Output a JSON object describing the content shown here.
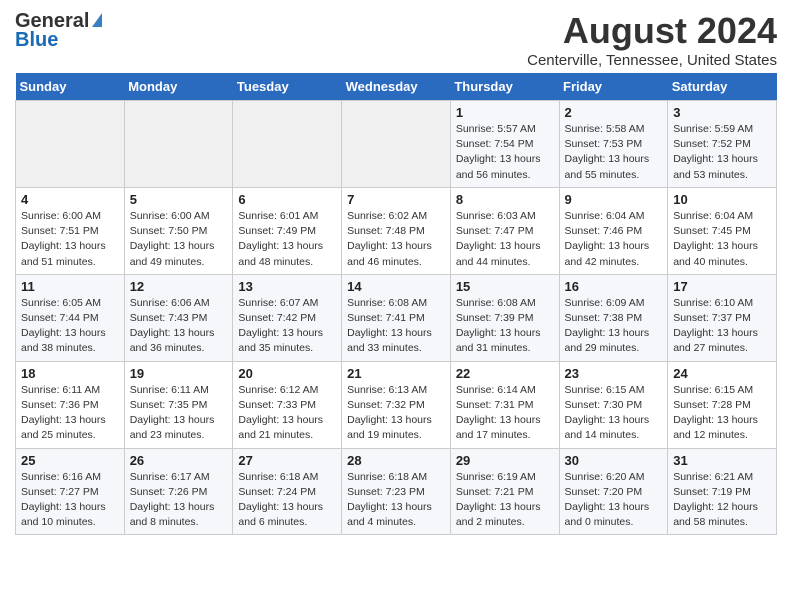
{
  "logo": {
    "general": "General",
    "blue": "Blue"
  },
  "title": "August 2024",
  "location": "Centerville, Tennessee, United States",
  "days_of_week": [
    "Sunday",
    "Monday",
    "Tuesday",
    "Wednesday",
    "Thursday",
    "Friday",
    "Saturday"
  ],
  "weeks": [
    [
      {
        "day": "",
        "info": ""
      },
      {
        "day": "",
        "info": ""
      },
      {
        "day": "",
        "info": ""
      },
      {
        "day": "",
        "info": ""
      },
      {
        "day": "1",
        "info": "Sunrise: 5:57 AM\nSunset: 7:54 PM\nDaylight: 13 hours\nand 56 minutes."
      },
      {
        "day": "2",
        "info": "Sunrise: 5:58 AM\nSunset: 7:53 PM\nDaylight: 13 hours\nand 55 minutes."
      },
      {
        "day": "3",
        "info": "Sunrise: 5:59 AM\nSunset: 7:52 PM\nDaylight: 13 hours\nand 53 minutes."
      }
    ],
    [
      {
        "day": "4",
        "info": "Sunrise: 6:00 AM\nSunset: 7:51 PM\nDaylight: 13 hours\nand 51 minutes."
      },
      {
        "day": "5",
        "info": "Sunrise: 6:00 AM\nSunset: 7:50 PM\nDaylight: 13 hours\nand 49 minutes."
      },
      {
        "day": "6",
        "info": "Sunrise: 6:01 AM\nSunset: 7:49 PM\nDaylight: 13 hours\nand 48 minutes."
      },
      {
        "day": "7",
        "info": "Sunrise: 6:02 AM\nSunset: 7:48 PM\nDaylight: 13 hours\nand 46 minutes."
      },
      {
        "day": "8",
        "info": "Sunrise: 6:03 AM\nSunset: 7:47 PM\nDaylight: 13 hours\nand 44 minutes."
      },
      {
        "day": "9",
        "info": "Sunrise: 6:04 AM\nSunset: 7:46 PM\nDaylight: 13 hours\nand 42 minutes."
      },
      {
        "day": "10",
        "info": "Sunrise: 6:04 AM\nSunset: 7:45 PM\nDaylight: 13 hours\nand 40 minutes."
      }
    ],
    [
      {
        "day": "11",
        "info": "Sunrise: 6:05 AM\nSunset: 7:44 PM\nDaylight: 13 hours\nand 38 minutes."
      },
      {
        "day": "12",
        "info": "Sunrise: 6:06 AM\nSunset: 7:43 PM\nDaylight: 13 hours\nand 36 minutes."
      },
      {
        "day": "13",
        "info": "Sunrise: 6:07 AM\nSunset: 7:42 PM\nDaylight: 13 hours\nand 35 minutes."
      },
      {
        "day": "14",
        "info": "Sunrise: 6:08 AM\nSunset: 7:41 PM\nDaylight: 13 hours\nand 33 minutes."
      },
      {
        "day": "15",
        "info": "Sunrise: 6:08 AM\nSunset: 7:39 PM\nDaylight: 13 hours\nand 31 minutes."
      },
      {
        "day": "16",
        "info": "Sunrise: 6:09 AM\nSunset: 7:38 PM\nDaylight: 13 hours\nand 29 minutes."
      },
      {
        "day": "17",
        "info": "Sunrise: 6:10 AM\nSunset: 7:37 PM\nDaylight: 13 hours\nand 27 minutes."
      }
    ],
    [
      {
        "day": "18",
        "info": "Sunrise: 6:11 AM\nSunset: 7:36 PM\nDaylight: 13 hours\nand 25 minutes."
      },
      {
        "day": "19",
        "info": "Sunrise: 6:11 AM\nSunset: 7:35 PM\nDaylight: 13 hours\nand 23 minutes."
      },
      {
        "day": "20",
        "info": "Sunrise: 6:12 AM\nSunset: 7:33 PM\nDaylight: 13 hours\nand 21 minutes."
      },
      {
        "day": "21",
        "info": "Sunrise: 6:13 AM\nSunset: 7:32 PM\nDaylight: 13 hours\nand 19 minutes."
      },
      {
        "day": "22",
        "info": "Sunrise: 6:14 AM\nSunset: 7:31 PM\nDaylight: 13 hours\nand 17 minutes."
      },
      {
        "day": "23",
        "info": "Sunrise: 6:15 AM\nSunset: 7:30 PM\nDaylight: 13 hours\nand 14 minutes."
      },
      {
        "day": "24",
        "info": "Sunrise: 6:15 AM\nSunset: 7:28 PM\nDaylight: 13 hours\nand 12 minutes."
      }
    ],
    [
      {
        "day": "25",
        "info": "Sunrise: 6:16 AM\nSunset: 7:27 PM\nDaylight: 13 hours\nand 10 minutes."
      },
      {
        "day": "26",
        "info": "Sunrise: 6:17 AM\nSunset: 7:26 PM\nDaylight: 13 hours\nand 8 minutes."
      },
      {
        "day": "27",
        "info": "Sunrise: 6:18 AM\nSunset: 7:24 PM\nDaylight: 13 hours\nand 6 minutes."
      },
      {
        "day": "28",
        "info": "Sunrise: 6:18 AM\nSunset: 7:23 PM\nDaylight: 13 hours\nand 4 minutes."
      },
      {
        "day": "29",
        "info": "Sunrise: 6:19 AM\nSunset: 7:21 PM\nDaylight: 13 hours\nand 2 minutes."
      },
      {
        "day": "30",
        "info": "Sunrise: 6:20 AM\nSunset: 7:20 PM\nDaylight: 13 hours\nand 0 minutes."
      },
      {
        "day": "31",
        "info": "Sunrise: 6:21 AM\nSunset: 7:19 PM\nDaylight: 12 hours\nand 58 minutes."
      }
    ]
  ]
}
